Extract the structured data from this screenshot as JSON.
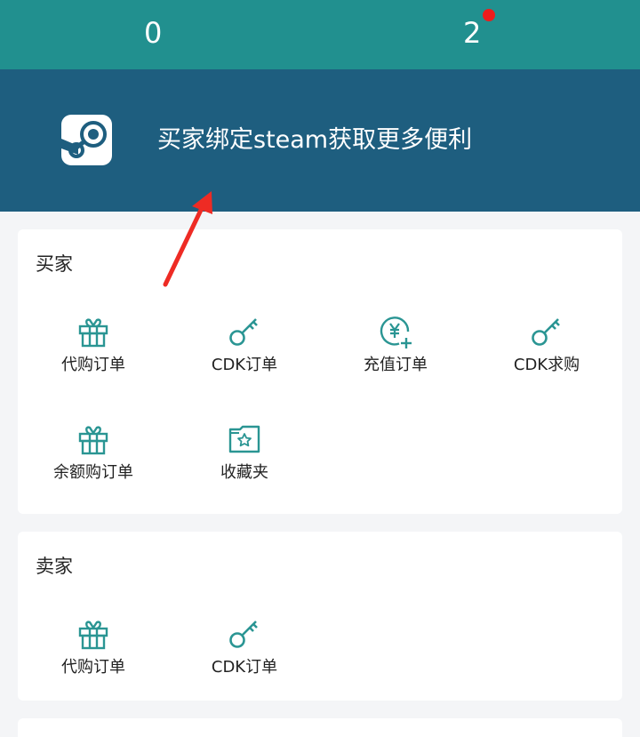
{
  "header": {
    "stat_left": "0",
    "stat_right": "2",
    "badge_color": "#ee1c1c"
  },
  "banner": {
    "text": "买家绑定steam获取更多便利",
    "logo": "steam-icon"
  },
  "buyer": {
    "title": "买家",
    "items": [
      {
        "label": "代购订单",
        "icon": "gift-icon"
      },
      {
        "label": "CDK订单",
        "icon": "key-icon"
      },
      {
        "label": "充值订单",
        "icon": "yen-coin-plus-icon"
      },
      {
        "label": "CDK求购",
        "icon": "key-icon"
      },
      {
        "label": "余额购订单",
        "icon": "gift-icon"
      },
      {
        "label": "收藏夹",
        "icon": "star-folder-icon"
      }
    ]
  },
  "seller": {
    "title": "卖家",
    "items": [
      {
        "label": "代购订单",
        "icon": "gift-icon"
      },
      {
        "label": "CDK订单",
        "icon": "key-icon"
      }
    ]
  },
  "colors": {
    "header_bg": "#21908f",
    "banner_bg": "#1e5e7f",
    "icon_teal": "#2a9593",
    "arrow_red": "#ee2b24"
  }
}
